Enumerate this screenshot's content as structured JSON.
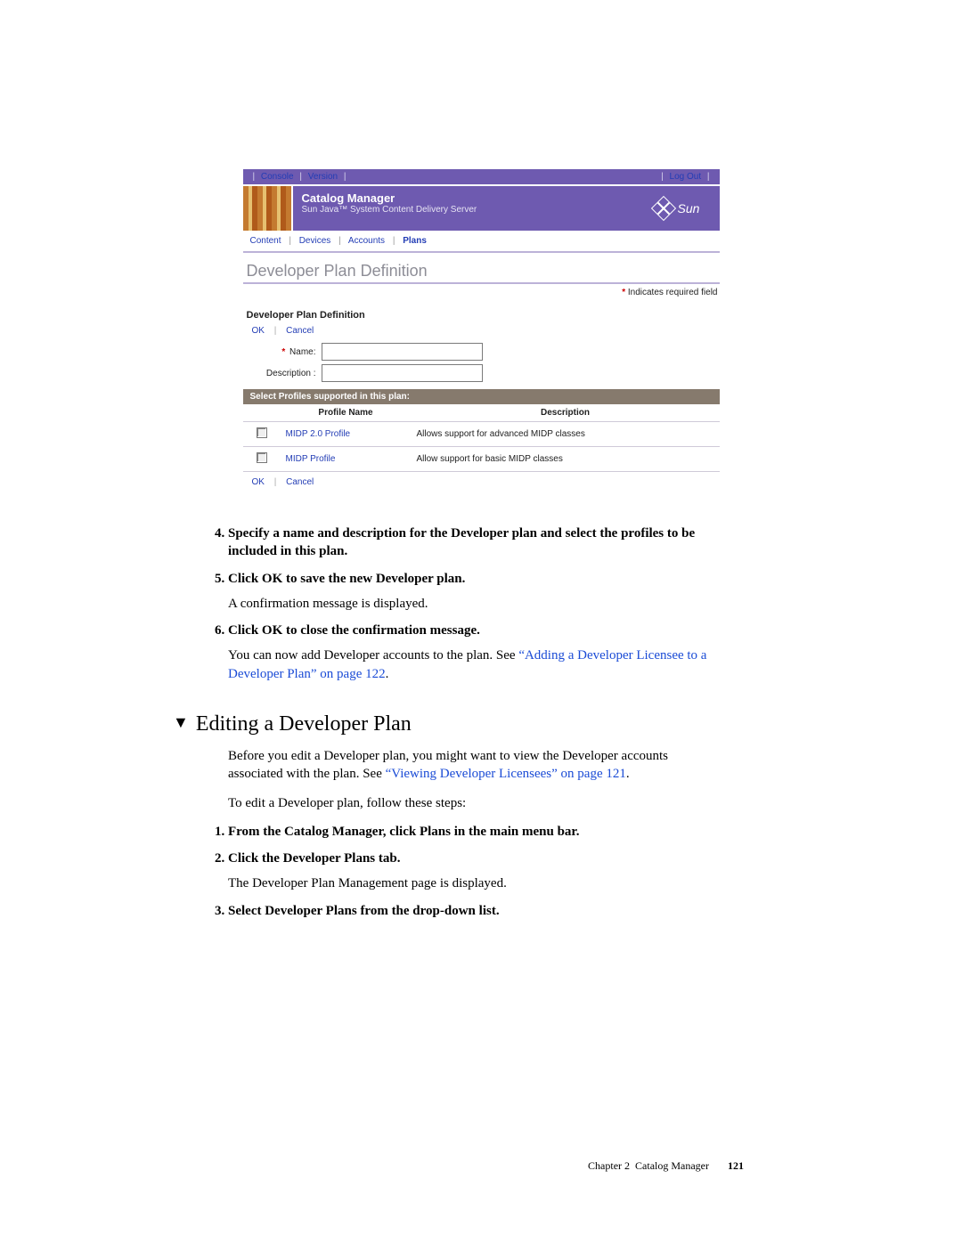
{
  "screenshot": {
    "topbar": {
      "console": "Console",
      "version": "Version",
      "logout": "Log Out"
    },
    "banner": {
      "title": "Catalog Manager",
      "subtitle": "Sun Java™ System Content Delivery Server",
      "sun_text": "Sun"
    },
    "menu": {
      "content": "Content",
      "devices": "Devices",
      "accounts": "Accounts",
      "plans": "Plans"
    },
    "page_title": "Developer Plan Definition",
    "required_note": "Indicates required field",
    "section_title": "Developer Plan Definition",
    "buttons": {
      "ok": "OK",
      "cancel": "Cancel"
    },
    "fields": {
      "name_label": "Name:",
      "desc_label": "Description :"
    },
    "profiles_bar": "Select Profiles supported in this plan:",
    "profiles": {
      "col_name": "Profile Name",
      "col_desc": "Description",
      "rows": [
        {
          "name": "MIDP 2.0 Profile",
          "desc": "Allows support for advanced MIDP classes"
        },
        {
          "name": "MIDP Profile",
          "desc": "Allow support for basic MIDP classes"
        }
      ]
    }
  },
  "doc": {
    "steps_a": {
      "s4": "Specify a name and description for the Developer plan and select the profiles to be included in this plan.",
      "s5": "Click OK to save the new Developer plan.",
      "s5_body": "A confirmation message is displayed.",
      "s6": "Click OK to close the confirmation message.",
      "s6_body_pre": "You can now add Developer accounts to the plan. See ",
      "s6_link": "“Adding a Developer Licensee to a Developer Plan” on page 122",
      "s6_body_post": "."
    },
    "heading": "Editing a Developer Plan",
    "intro_pre": "Before you edit a Developer plan, you might want to view the Developer accounts associated with the plan. See ",
    "intro_link": "“Viewing Developer Licensees” on page 121",
    "intro_post": ".",
    "intro2": "To edit a Developer plan, follow these steps:",
    "steps_b": {
      "s1": "From the Catalog Manager, click Plans in the main menu bar.",
      "s2": "Click the Developer Plans tab.",
      "s2_body": "The Developer Plan Management page is displayed.",
      "s3": "Select Developer Plans from the drop-down list."
    }
  },
  "footer": {
    "chapter": "Chapter 2",
    "title": "Catalog Manager",
    "page": "121"
  }
}
